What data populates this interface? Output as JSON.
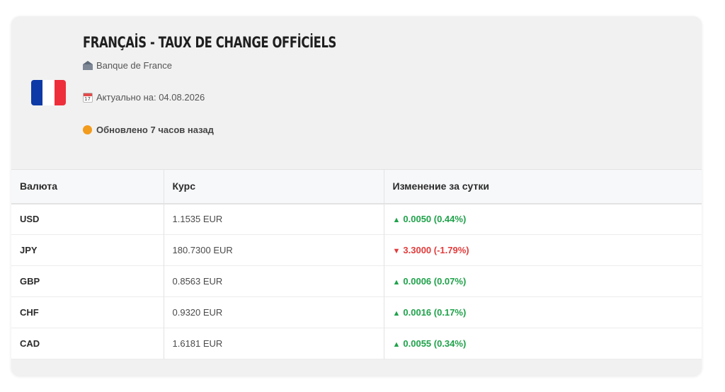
{
  "header": {
    "title": "FRANÇAİS - TAUX DE CHANGE OFFİCİELS",
    "bank": "Banque de France",
    "date_label": "Актуально на: 04.08.2026",
    "updated": "Обновлено 7 часов назад",
    "flag_icon": "france-flag-icon",
    "status_color": "#f29b1c"
  },
  "table": {
    "columns": [
      "Валюта",
      "Курс",
      "Изменение за сутки"
    ],
    "rows": [
      {
        "currency": "USD",
        "rate": "1.1535 EUR",
        "direction": "up",
        "arrow": "▲",
        "change": "0.0050 (0.44%)"
      },
      {
        "currency": "JPY",
        "rate": "180.7300 EUR",
        "direction": "down",
        "arrow": "▼",
        "change": "3.3000 (-1.79%)"
      },
      {
        "currency": "GBP",
        "rate": "0.8563 EUR",
        "direction": "up",
        "arrow": "▲",
        "change": "0.0006 (0.07%)"
      },
      {
        "currency": "CHF",
        "rate": "0.9320 EUR",
        "direction": "up",
        "arrow": "▲",
        "change": "0.0016 (0.17%)"
      },
      {
        "currency": "CAD",
        "rate": "1.6181 EUR",
        "direction": "up",
        "arrow": "▲",
        "change": "0.0055 (0.34%)"
      }
    ]
  },
  "colors": {
    "up": "#1fa24a",
    "down": "#e23b3b"
  }
}
